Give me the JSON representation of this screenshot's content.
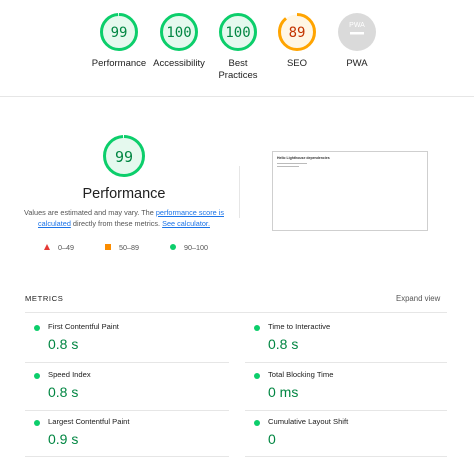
{
  "top_gauges": [
    {
      "score": "99",
      "label": "Performance",
      "color": "#0cce6b",
      "fill": 0.99
    },
    {
      "score": "100",
      "label": "Accessibility",
      "color": "#0cce6b",
      "fill": 1.0
    },
    {
      "score": "100",
      "label_line1": "Best",
      "label_line2": "Practices",
      "color": "#0cce6b",
      "fill": 1.0
    },
    {
      "score": "89",
      "label": "SEO",
      "color": "#ffa400",
      "fill": 0.89
    },
    {
      "badge": "PWA",
      "label": "PWA",
      "color": "#cccccc"
    }
  ],
  "performance": {
    "score": "99",
    "fill": 0.99,
    "title": "Performance",
    "note_prefix": "Values are estimated and may vary. The ",
    "note_link1": "performance score is calculated",
    "note_middle": " directly from these metrics. ",
    "note_link2": "See calculator.",
    "legend": [
      {
        "icon": "triangle-fail-icon",
        "range": "0–49",
        "color": "#e53935"
      },
      {
        "icon": "square-average-icon",
        "range": "50–89",
        "color": "#fb8c00"
      },
      {
        "icon": "circle-pass-icon",
        "range": "90–100",
        "color": "#0cce6b"
      }
    ],
    "screenshot_heading": "Hello Lighthouse dependencies"
  },
  "metrics": {
    "heading": "METRICS",
    "expand_label": "Expand view",
    "items": [
      {
        "name": "First Contentful Paint",
        "value": "0.8 s"
      },
      {
        "name": "Time to Interactive",
        "value": "0.8 s"
      },
      {
        "name": "Speed Index",
        "value": "0.8 s"
      },
      {
        "name": "Total Blocking Time",
        "value": "0 ms"
      },
      {
        "name": "Largest Contentful Paint",
        "value": "0.9 s"
      },
      {
        "name": "Cumulative Layout Shift",
        "value": "0"
      }
    ]
  }
}
